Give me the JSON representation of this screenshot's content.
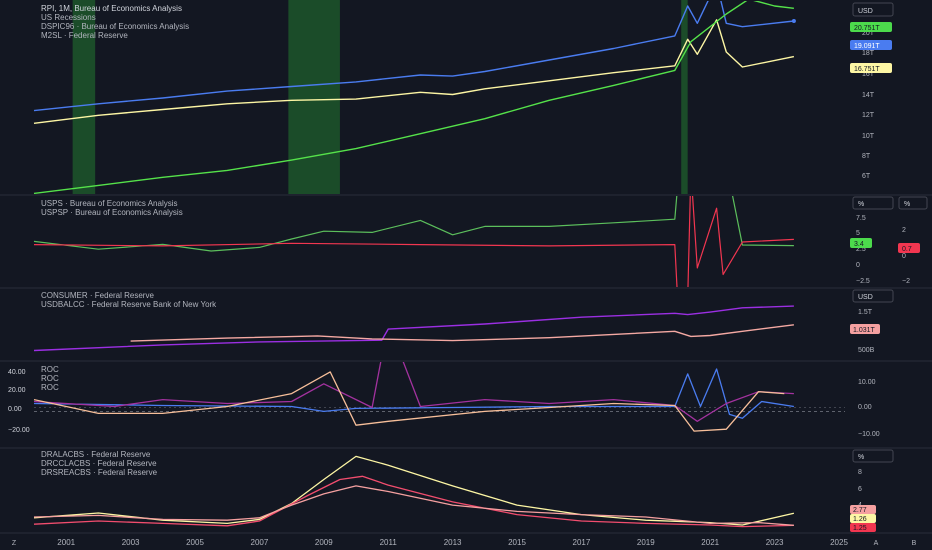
{
  "colors": {
    "background": "#131722",
    "separator": "#2a2e39",
    "axis_text": "#b2b5be",
    "recession": "#1f5f2c",
    "rpi": "#4a7cf0",
    "dspic96": "#fdf6a4",
    "m2sl": "#55e24a",
    "usps": "#5cbf5c",
    "usps_alt": "#4cdb4c",
    "uspsp": "#f23650",
    "consumer": "#9b2fe3",
    "usdbalcc": "#f5a9a3",
    "roc_rpi": "#4a7cf0",
    "roc_consumer": "#a3329f",
    "roc_usdbalcc": "#f7bf9a",
    "dralacbs": "#fdf6a4",
    "drcclacbs": "#f24d6e",
    "drsreacbs": "#f5a0a0",
    "badge_green": "#4cdb4c",
    "badge_blue": "#4a7cf0",
    "badge_yellow": "#fdf6a4",
    "badge_red": "#f23650",
    "badge_pink": "#f5a0a0"
  },
  "panes": {
    "main": {
      "title": "RPI, 1M, Bureau of Economics Analysis",
      "legend": [
        "US Recessions",
        "DSPIC96 · Bureau of Economics Analysis",
        "M2SL · Federal Reserve"
      ],
      "scale_button": "USD",
      "y_ticks": [
        "20T",
        "18T",
        "16T",
        "14T",
        "12T",
        "10T",
        "8T",
        "6T"
      ],
      "badges": [
        "20.751T",
        "19.091T",
        "16.751T"
      ]
    },
    "second": {
      "legend": [
        "USPS · Bureau of Economics Analysis",
        "USPSP · Bureau of Economics Analysis"
      ],
      "scale_buttons": [
        "%",
        "%"
      ],
      "y_ticks_left": [
        "7.5",
        "5",
        "2.5",
        "0",
        "−2.5"
      ],
      "y_ticks_right": [
        "2",
        "0",
        "−2"
      ],
      "badges": [
        "3.4",
        "0.7"
      ]
    },
    "third": {
      "legend": [
        "CONSUMER · Federal Reserve",
        "USDBALCC · Federal Reserve Bank of New York"
      ],
      "scale_button": "USD",
      "y_ticks": [
        "1.5T",
        "500B"
      ],
      "badges": [
        "1.031T"
      ]
    },
    "fourth": {
      "legend": [
        "ROC",
        "ROC",
        "ROC"
      ],
      "left_ticks": [
        "40.00",
        "20.00",
        "0.00",
        "−20.00"
      ],
      "right_ticks": [
        "10.00",
        "0.00",
        "−10.00"
      ]
    },
    "fifth": {
      "legend": [
        "DRALACBS · Federal Reserve",
        "DRCCLACBS · Federal Reserve",
        "DRSREACBS · Federal Reserve"
      ],
      "scale_button": "%",
      "y_ticks": [
        "8",
        "6",
        "4"
      ],
      "badges": [
        "2.77",
        "1.26",
        "1.25"
      ]
    }
  },
  "x_axis": {
    "labels": [
      "2001",
      "2003",
      "2005",
      "2007",
      "2009",
      "2011",
      "2013",
      "2015",
      "2017",
      "2019",
      "2021",
      "2023",
      "2025"
    ],
    "corner_left": "Z",
    "corner_mid": "A",
    "corner_right": "B"
  },
  "chart_data": [
    {
      "type": "line",
      "title": "RPI, 1M, Bureau of Economics Analysis",
      "x_range": [
        2000.0,
        2023.6
      ],
      "y_range": [
        5,
        21
      ],
      "y_unit": "T USD",
      "recessions": [
        [
          2001.2,
          2001.9
        ],
        [
          2007.9,
          2009.5
        ],
        [
          2020.1,
          2020.3
        ]
      ],
      "series": [
        {
          "name": "RPI",
          "points": [
            [
              2000,
              11.9
            ],
            [
              2002,
              12.5
            ],
            [
              2004,
              13.0
            ],
            [
              2006,
              13.6
            ],
            [
              2008,
              14.0
            ],
            [
              2010,
              14.4
            ],
            [
              2012,
              15.0
            ],
            [
              2013,
              14.9
            ],
            [
              2014,
              15.3
            ],
            [
              2016,
              16.3
            ],
            [
              2018,
              17.3
            ],
            [
              2019.9,
              18.4
            ],
            [
              2020.3,
              21.0
            ],
            [
              2020.6,
              19.5
            ],
            [
              2021.2,
              23.0
            ],
            [
              2021.5,
              19.5
            ],
            [
              2022,
              19.2
            ],
            [
              2023.6,
              19.7
            ]
          ]
        },
        {
          "name": "DSPIC96",
          "points": [
            [
              2000,
              10.8
            ],
            [
              2002,
              11.5
            ],
            [
              2004,
              12.0
            ],
            [
              2006,
              12.5
            ],
            [
              2008,
              12.8
            ],
            [
              2010,
              12.9
            ],
            [
              2012,
              13.5
            ],
            [
              2013,
              13.3
            ],
            [
              2014,
              13.8
            ],
            [
              2016,
              14.5
            ],
            [
              2018,
              15.2
            ],
            [
              2019.9,
              15.8
            ],
            [
              2020.3,
              18.1
            ],
            [
              2020.6,
              16.8
            ],
            [
              2021.2,
              19.8
            ],
            [
              2021.5,
              17.0
            ],
            [
              2022,
              15.7
            ],
            [
              2023.6,
              16.6
            ]
          ]
        },
        {
          "name": "M2SL",
          "points": [
            [
              2000,
              4.7
            ],
            [
              2002,
              5.4
            ],
            [
              2004,
              6.1
            ],
            [
              2006,
              6.7
            ],
            [
              2008,
              7.6
            ],
            [
              2010,
              8.6
            ],
            [
              2012,
              9.9
            ],
            [
              2014,
              11.2
            ],
            [
              2016,
              12.8
            ],
            [
              2018,
              14.1
            ],
            [
              2019.9,
              15.4
            ],
            [
              2020.4,
              17.9
            ],
            [
              2021.5,
              20.3
            ],
            [
              2022.2,
              21.6
            ],
            [
              2023,
              21.0
            ],
            [
              2023.6,
              20.8
            ]
          ]
        }
      ]
    },
    {
      "type": "line",
      "x_range": [
        2000.0,
        2023.6
      ],
      "series": [
        {
          "name": "USPS",
          "y_unit": "%",
          "y_range": [
            -2.5,
            10.5
          ],
          "points": [
            [
              2000,
              4.1
            ],
            [
              2002,
              2.8
            ],
            [
              2004,
              3.6
            ],
            [
              2005.5,
              2.5
            ],
            [
              2007,
              3.1
            ],
            [
              2008,
              4.5
            ],
            [
              2009,
              5.8
            ],
            [
              2010.5,
              5.6
            ],
            [
              2012,
              7.6
            ],
            [
              2013,
              5.2
            ],
            [
              2014,
              6.6
            ],
            [
              2016,
              6.6
            ],
            [
              2018,
              7.2
            ],
            [
              2019.9,
              7.8
            ],
            [
              2020.3,
              33.0
            ],
            [
              2021.2,
              25.0
            ],
            [
              2022,
              3.5
            ],
            [
              2023.6,
              3.4
            ]
          ]
        },
        {
          "name": "USPSP",
          "y_unit": "%",
          "y_range": [
            -2.5,
            3.5
          ],
          "points": [
            [
              2000,
              0.3
            ],
            [
              2004,
              0.2
            ],
            [
              2008,
              0.4
            ],
            [
              2012,
              0.3
            ],
            [
              2016,
              0.2
            ],
            [
              2019.9,
              0.3
            ],
            [
              2020.2,
              -14.0
            ],
            [
              2020.4,
              6.0
            ],
            [
              2020.6,
              -1.5
            ],
            [
              2021.2,
              3.1
            ],
            [
              2021.4,
              -2.0
            ],
            [
              2022,
              0.5
            ],
            [
              2023.6,
              0.7
            ]
          ]
        }
      ]
    },
    {
      "type": "line",
      "x_range": [
        2000.0,
        2023.6
      ],
      "y_unit": "USD",
      "y_range": [
        0.3,
        1.8
      ],
      "y_scale_units": "T",
      "series": [
        {
          "name": "CONSUMER",
          "points": [
            [
              2000,
              0.43
            ],
            [
              2004,
              0.56
            ],
            [
              2007,
              0.63
            ],
            [
              2010.8,
              0.67
            ],
            [
              2011.0,
              0.93
            ],
            [
              2014,
              1.05
            ],
            [
              2017,
              1.21
            ],
            [
              2019.9,
              1.3
            ],
            [
              2020.3,
              1.27
            ],
            [
              2021,
              1.33
            ],
            [
              2022,
              1.43
            ],
            [
              2023.6,
              1.47
            ]
          ]
        },
        {
          "name": "USDBALCC",
          "points": [
            [
              2003,
              0.65
            ],
            [
              2006,
              0.72
            ],
            [
              2008.8,
              0.77
            ],
            [
              2010.5,
              0.7
            ],
            [
              2013,
              0.66
            ],
            [
              2016,
              0.73
            ],
            [
              2019.9,
              0.88
            ],
            [
              2020.4,
              0.76
            ],
            [
              2021,
              0.78
            ],
            [
              2022,
              0.88
            ],
            [
              2023.6,
              1.031
            ]
          ]
        }
      ]
    },
    {
      "type": "line",
      "x_range": [
        2000.0,
        2023.6
      ],
      "series": [
        {
          "name": "ROC",
          "y_unit": "%",
          "y_range": [
            -30,
            45
          ],
          "points": [
            [
              2000,
              8
            ],
            [
              2004,
              6
            ],
            [
              2008,
              5
            ],
            [
              2009,
              0
            ],
            [
              2010,
              3
            ],
            [
              2013,
              4
            ],
            [
              2016,
              5
            ],
            [
              2019.9,
              5
            ],
            [
              2020.3,
              38
            ],
            [
              2020.7,
              5
            ],
            [
              2021.2,
              43
            ],
            [
              2021.6,
              -3
            ],
            [
              2022,
              -7
            ],
            [
              2022.6,
              10
            ],
            [
              2023.6,
              5
            ]
          ]
        },
        {
          "name": "ROC",
          "y_unit": "%",
          "y_range": [
            -30,
            45
          ],
          "points": [
            [
              2000,
              10
            ],
            [
              2002.5,
              5
            ],
            [
              2004,
              12
            ],
            [
              2006,
              8
            ],
            [
              2008,
              10
            ],
            [
              2009,
              28
            ],
            [
              2010.5,
              4
            ],
            [
              2011,
              90
            ],
            [
              2012,
              5
            ],
            [
              2014,
              12
            ],
            [
              2016,
              8
            ],
            [
              2018,
              12
            ],
            [
              2019.9,
              6
            ],
            [
              2020.6,
              -10
            ],
            [
              2021.5,
              8
            ],
            [
              2022.5,
              20
            ],
            [
              2023.6,
              18
            ]
          ]
        },
        {
          "name": "ROC",
          "y_unit": "%",
          "y_range": [
            -30,
            45
          ],
          "points": [
            [
              2000,
              12
            ],
            [
              2002,
              -2
            ],
            [
              2004,
              -2
            ],
            [
              2006,
              5
            ],
            [
              2008,
              18
            ],
            [
              2009.2,
              40
            ],
            [
              2010,
              -14
            ],
            [
              2011,
              -10
            ],
            [
              2014,
              0
            ],
            [
              2016,
              4
            ],
            [
              2018,
              8
            ],
            [
              2019.9,
              6
            ],
            [
              2020.5,
              -20
            ],
            [
              2021.5,
              -18
            ],
            [
              2022.5,
              20
            ],
            [
              2023.3,
              18
            ]
          ]
        }
      ]
    },
    {
      "type": "line",
      "x_range": [
        2000.0,
        2023.6
      ],
      "y_unit": "%",
      "y_range": [
        0.8,
        10.2
      ],
      "series": [
        {
          "name": "DRALACBS",
          "points": [
            [
              2000,
              2.2
            ],
            [
              2002,
              2.8
            ],
            [
              2004,
              1.9
            ],
            [
              2006,
              1.5
            ],
            [
              2007,
              2.0
            ],
            [
              2008,
              4.0
            ],
            [
              2009,
              7.0
            ],
            [
              2010.0,
              9.9
            ],
            [
              2011,
              8.8
            ],
            [
              2013,
              6.2
            ],
            [
              2015,
              3.8
            ],
            [
              2017,
              2.6
            ],
            [
              2019,
              1.9
            ],
            [
              2021,
              1.6
            ],
            [
              2022,
              1.3
            ],
            [
              2023.6,
              2.77
            ]
          ]
        },
        {
          "name": "DRCCLACBS",
          "points": [
            [
              2000,
              1.4
            ],
            [
              2002,
              1.8
            ],
            [
              2004,
              1.5
            ],
            [
              2006,
              1.2
            ],
            [
              2007,
              1.8
            ],
            [
              2008.5,
              5.0
            ],
            [
              2009.5,
              7.0
            ],
            [
              2010.2,
              7.4
            ],
            [
              2011,
              6.3
            ],
            [
              2013,
              4.2
            ],
            [
              2015,
              2.6
            ],
            [
              2017,
              1.8
            ],
            [
              2019,
              1.5
            ],
            [
              2021,
              1.3
            ],
            [
              2022,
              1.1
            ],
            [
              2023.6,
              1.25
            ]
          ]
        },
        {
          "name": "DRSREACBS",
          "points": [
            [
              2000,
              2.3
            ],
            [
              2002,
              2.5
            ],
            [
              2004,
              2.0
            ],
            [
              2006,
              1.9
            ],
            [
              2007,
              2.2
            ],
            [
              2008,
              3.8
            ],
            [
              2009,
              5.2
            ],
            [
              2010,
              6.2
            ],
            [
              2011,
              5.5
            ],
            [
              2013,
              3.8
            ],
            [
              2015,
              3.0
            ],
            [
              2017,
              2.6
            ],
            [
              2019,
              2.3
            ],
            [
              2021,
              1.5
            ],
            [
              2022.5,
              1.6
            ],
            [
              2023.6,
              1.26
            ]
          ]
        }
      ]
    }
  ]
}
